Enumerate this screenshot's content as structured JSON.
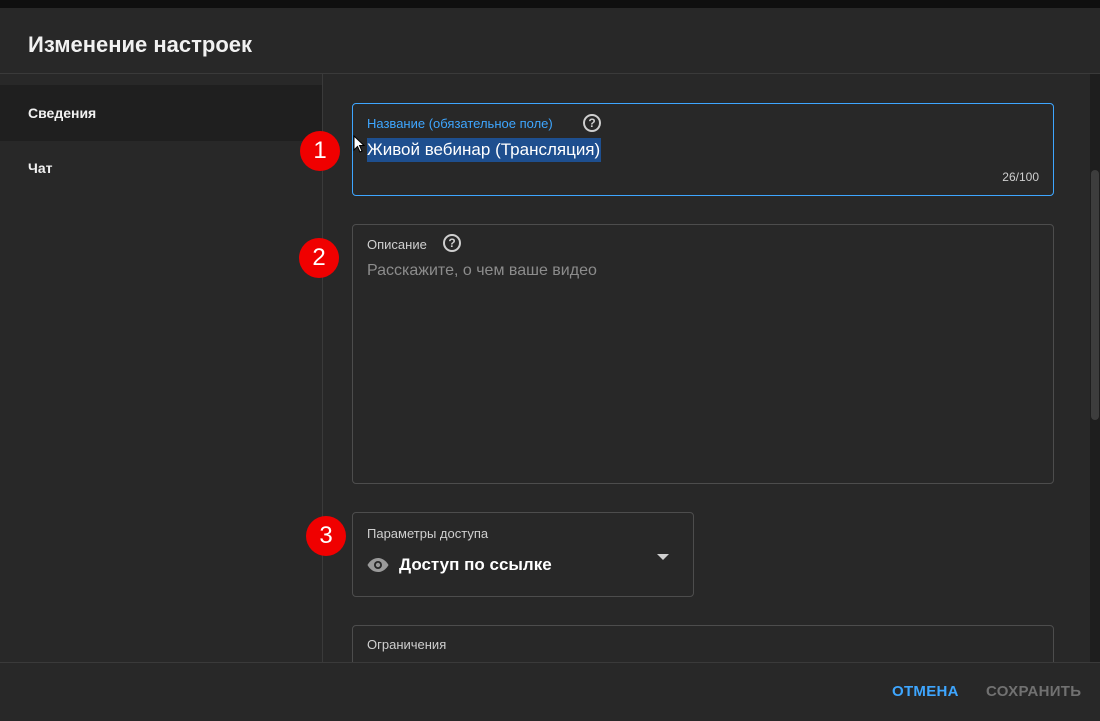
{
  "dialog": {
    "title": "Изменение настроек"
  },
  "sidebar": {
    "items": [
      {
        "label": "Сведения",
        "active": true
      },
      {
        "label": "Чат",
        "active": false
      }
    ]
  },
  "form": {
    "title_field": {
      "label": "Название (обязательное поле)",
      "value": "Живой вебинар (Трансляция)",
      "counter": "26/100"
    },
    "description_field": {
      "label": "Описание",
      "placeholder": "Расскажите, о чем ваше видео"
    },
    "access_field": {
      "label": "Параметры доступа",
      "value": "Доступ по ссылке",
      "icon": "eye-icon"
    },
    "restrictions_field": {
      "label": "Ограничения"
    }
  },
  "annotations": [
    "1",
    "2",
    "3"
  ],
  "footer": {
    "cancel_label": "ОТМЕНА",
    "save_label": "СОХРАНИТЬ"
  },
  "colors": {
    "accent": "#3ea6ff",
    "badge": "#f00000",
    "background": "#282828"
  }
}
